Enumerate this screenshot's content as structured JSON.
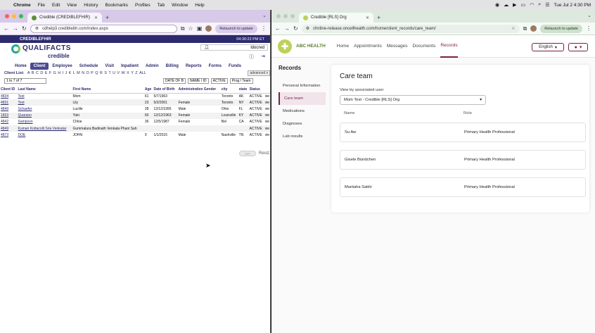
{
  "menubar": {
    "app": "Chrome",
    "items": [
      "File",
      "Edit",
      "View",
      "History",
      "Bookmarks",
      "Profiles",
      "Tab",
      "Window",
      "Help"
    ],
    "clock": "Tue Jul 2  4:30 PM"
  },
  "left_browser": {
    "tab_title": "Credible (CREDIBLEFHIR)",
    "url": "cdhelp3.crediblebh.com/index.aspx",
    "relaunch": "Relaunch to update",
    "app": {
      "org": "CREDIBLEFHIR",
      "time": "04:30:22 PM ET",
      "logo": "QUALIFACTS",
      "logo_sub": "credible",
      "username": "ldocred",
      "nav": [
        "Home",
        "Client",
        "Employee",
        "Schedule",
        "Visit",
        "Inpatient",
        "Admin",
        "Billing",
        "Reports",
        "Forms",
        "Funds"
      ],
      "active_nav": "Client",
      "client_list_label": "Client List:",
      "letters": [
        "A",
        "B",
        "C",
        "D",
        "E",
        "F",
        "G",
        "H",
        "I",
        "J",
        "K",
        "L",
        "M",
        "N",
        "O",
        "P",
        "Q",
        "R",
        "S",
        "T",
        "U",
        "V",
        "W",
        "X",
        "Y",
        "Z",
        "ALL"
      ],
      "advanced": "advanced s",
      "range": "1 to 7 of 7",
      "filters": [
        "DATE OF B",
        "NAME / ID",
        "ACTIVE",
        "Prog / Team"
      ],
      "columns": [
        "Client ID",
        "Last Name",
        "First Name",
        "Age",
        "Date of Birth",
        "Administrative Gender",
        "city",
        "state",
        "Status",
        ""
      ],
      "rows": [
        [
          "4834",
          "Test",
          "Mom",
          "61",
          "5/7/1963",
          "",
          "Toronto",
          "AK",
          "ACTIVE",
          "vie"
        ],
        [
          "4831",
          "Test",
          "Lily",
          "23",
          "5/2/2001",
          "Female",
          "Toronto",
          "NY",
          "ACTIVE",
          "vie"
        ],
        [
          "4849",
          "Schaefer",
          "Lucille",
          "28",
          "12/12/1995",
          "Male",
          "Ohio",
          "FL",
          "ACTIVE",
          "vie"
        ],
        [
          "1833",
          "Quaraoo",
          "Yuki",
          "60",
          "12/12/1963",
          "Female",
          "Louisville",
          "KY",
          "ACTIVE",
          "vie"
        ],
        [
          "4842",
          "Sampson",
          "Chloe",
          "36",
          "12/5/1987",
          "Female",
          "Bel",
          "CA",
          "ACTIVE",
          "vie"
        ],
        [
          "4849",
          "Kumari Kottacolli Sria Venkatar",
          "Gummalura Badinath Venkata Phani Sah",
          "",
          "",
          "",
          "",
          "",
          "ACTIVE",
          "vie"
        ],
        [
          "4873",
          "DOE",
          "JOHN",
          "9",
          "1/1/2015",
          "Male",
          "Nashville",
          "TN",
          "ACTIVE",
          "vie"
        ]
      ],
      "toggle_off": "OFF",
      "toggle_label": "Resiz"
    }
  },
  "right_browser": {
    "tab_title": "Credible [RLS] Org",
    "url": "chnline-release.oncellhealth.com/home/client_records/care_team/",
    "relaunch": "Relaunch to update",
    "app": {
      "brand": "ABC HEALTH",
      "nav": [
        "Home",
        "Appointments",
        "Messages",
        "Documents",
        "Records"
      ],
      "active_nav": "Records",
      "language": "English",
      "records_title": "Records",
      "side_items": [
        "Personal Information",
        "Care team",
        "Medications",
        "Diagnoses",
        "Lab results"
      ],
      "active_side": "Care team",
      "panel_title": "Care team",
      "view_label": "View by associated user",
      "selected_user": "Mom Test - Credible [RLS] Org",
      "col_name": "Name",
      "col_role": "Role",
      "rows": [
        {
          "name": "Su Aw",
          "role": "Primary Health Professional"
        },
        {
          "name": "Gisele Bündchen",
          "role": "Primary Health Professional"
        },
        {
          "name": "Muntaha Sakhi",
          "role": "Primary Health Professional"
        }
      ]
    }
  },
  "colors": {
    "credible_navy": "#2c2a6e",
    "abc_accent": "#7a1f45",
    "abc_green": "#5a7b2a"
  }
}
